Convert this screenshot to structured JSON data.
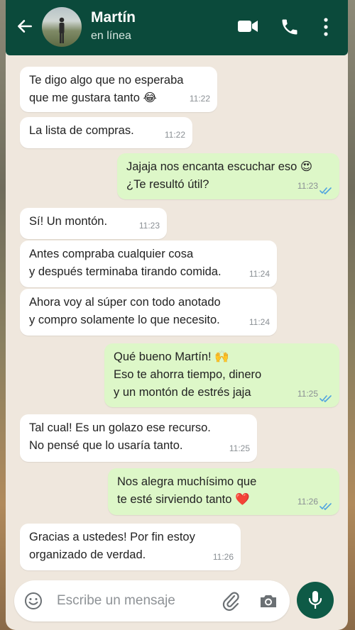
{
  "header": {
    "contact_name": "Martín",
    "status": "en línea",
    "icons": [
      "back-arrow-icon",
      "avatar",
      "video-call-icon",
      "phone-call-icon",
      "more-options-icon"
    ]
  },
  "messages": [
    {
      "dir": "in",
      "text": "Te digo algo que no esperaba\nque me gustara tanto 😂",
      "time": "11:22"
    },
    {
      "dir": "in",
      "text": "La lista de compras.",
      "time": "11:22"
    },
    {
      "dir": "out",
      "text": "Jajaja nos encanta escuchar eso 😍\n¿Te resultó útil?",
      "time": "11:23",
      "read": true
    },
    {
      "dir": "in",
      "text": "Sí! Un montón.",
      "time": "11:23"
    },
    {
      "dir": "in",
      "text": "Antes compraba cualquier cosa\ny después terminaba tirando comida.",
      "time": "11:24"
    },
    {
      "dir": "in",
      "text": "Ahora voy al súper con todo anotado\ny compro solamente lo que necesito.",
      "time": "11:24"
    },
    {
      "dir": "out",
      "text": "Qué bueno Martín! 🙌\nEso te ahorra tiempo, dinero\ny un montón de estrés jaja",
      "time": "11:25",
      "read": true
    },
    {
      "dir": "in",
      "text": "Tal cual! Es un golazo ese recurso.\nNo pensé que lo usaría tanto.",
      "time": "11:25"
    },
    {
      "dir": "out",
      "text": "Nos alegra muchísimo que\nte esté sirviendo tanto ❤️",
      "time": "11:26",
      "read": true
    },
    {
      "dir": "in",
      "text": "Gracias a ustedes! Por fin estoy\norganizado de verdad.",
      "time": "11:26"
    }
  ],
  "composer": {
    "placeholder": "Escribe un mensaje",
    "icons": [
      "emoji-icon",
      "attach-icon",
      "camera-icon",
      "microphone-icon"
    ]
  },
  "colors": {
    "header": "#0b4a3b",
    "outgoing_bubble": "#ddf7c8",
    "incoming_bubble": "#ffffff",
    "chat_background": "#efe7dd",
    "read_ticks": "#4fa3e0",
    "mic_button": "#0e5a46"
  }
}
